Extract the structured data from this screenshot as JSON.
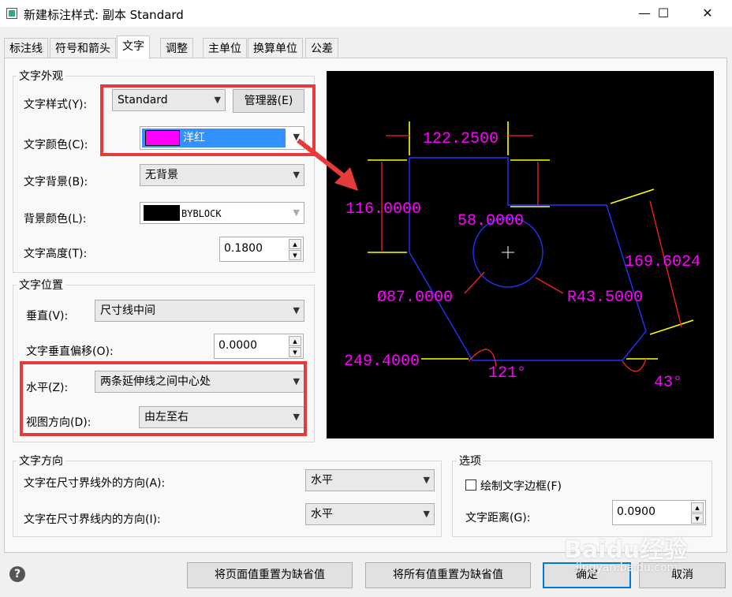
{
  "window": {
    "title": "新建标注样式: 副本 Standard",
    "minimize": "—",
    "maximize": "☐",
    "close": "✕"
  },
  "tabs": [
    "标注线",
    "符号和箭头",
    "文字",
    "调整",
    "主单位",
    "换算单位",
    "公差"
  ],
  "active_tab": "文字",
  "appearance": {
    "legend": "文字外观",
    "style_label": "文字样式(Y):",
    "style_value": "Standard",
    "manager_button": "管理器(E)",
    "color_label": "文字颜色(C):",
    "color_value": "洋红",
    "color_swatch": "#ff00ff",
    "bg_label": "文字背景(B):",
    "bg_value": "无背景",
    "bgcolor_label": "背景颜色(L):",
    "bgcolor_value": "BYBLOCK",
    "bgcolor_swatch": "#000000",
    "height_label": "文字高度(T):",
    "height_value": "0.1800"
  },
  "position": {
    "legend": "文字位置",
    "vertical_label": "垂直(V):",
    "vertical_value": "尺寸线中间",
    "offset_label": "文字垂直偏移(O):",
    "offset_value": "0.0000",
    "horizontal_label": "水平(Z):",
    "horizontal_value": "两条延伸线之间中心处",
    "view_label": "视图方向(D):",
    "view_value": "由左至右"
  },
  "direction": {
    "legend": "文字方向",
    "outside_label": "文字在尺寸界线外的方向(A):",
    "outside_value": "水平",
    "inside_label": "文字在尺寸界线内的方向(I):",
    "inside_value": "水平"
  },
  "options": {
    "legend": "选项",
    "frame_label": "绘制文字边框(F)",
    "frame_checked": false,
    "distance_label": "文字距离(G):",
    "distance_value": "0.0900"
  },
  "preview_labels": {
    "d1": "122.2500",
    "d2": "116.0000",
    "d3": "58.0000",
    "d4": "169.6024",
    "d5": "Ø87.0000",
    "d6": "R43.5000",
    "d7": "249.4000",
    "d8": "121°",
    "d9": "43°"
  },
  "footer": {
    "help": "?",
    "reset_page": "将页面值重置为缺省值",
    "reset_all": "将所有值重置为缺省值",
    "ok": "确定",
    "cancel": "取消"
  },
  "watermark": {
    "main": "Baidu经验",
    "sub": "jingyan.baidu.com"
  },
  "colors": {
    "accent_red": "#e63b3b",
    "magenta": "#ff00ff",
    "preview_bg": "#000000"
  }
}
